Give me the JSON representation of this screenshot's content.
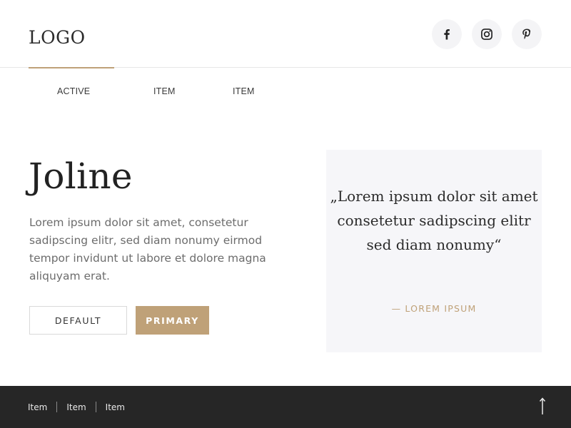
{
  "header": {
    "logo": "LOGO",
    "socials": [
      {
        "name": "facebook-icon"
      },
      {
        "name": "instagram-icon"
      },
      {
        "name": "pinterest-icon"
      }
    ]
  },
  "nav": {
    "items": [
      {
        "label": "ACTIVE",
        "active": true
      },
      {
        "label": "ITEM",
        "active": false
      },
      {
        "label": "ITEM",
        "active": false
      }
    ]
  },
  "hero": {
    "title": "Joline",
    "text": "Lorem ipsum dolor sit amet, consetetur sadipscing elitr, sed diam nonumy eirmod tempor invidunt ut labore et dolore magna aliquyam erat.",
    "default_button": "DEFAULT",
    "primary_button": "PRIMARY"
  },
  "quote": {
    "text": "„Lorem ipsum dolor sit amet consetetur sadipscing elitr sed diam nonumy“",
    "author": "— LOREM IPSUM"
  },
  "footer": {
    "links": [
      "Item",
      "Item",
      "Item"
    ],
    "back_to_top_icon": "arrow-up-icon"
  },
  "colors": {
    "accent": "#bfa178",
    "footer_bg": "#262626",
    "quote_bg": "#f6f6f9",
    "social_bg": "#f4f4f6"
  }
}
